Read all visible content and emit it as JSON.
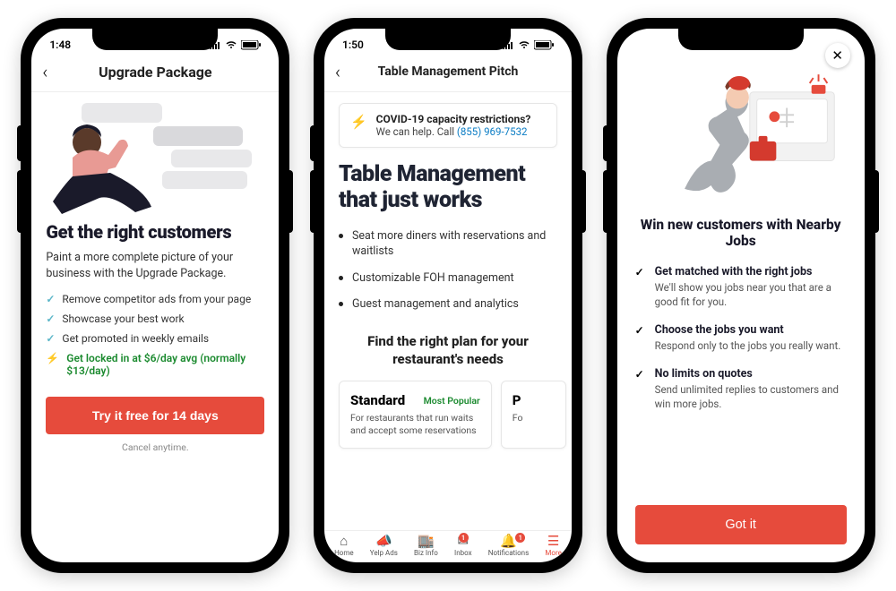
{
  "screen1": {
    "time": "1:48",
    "title": "Upgrade Package",
    "headline": "Get the right customers",
    "sub": "Paint a more complete picture of your business with the Upgrade Package.",
    "features": [
      "Remove competitor ads from your page",
      "Showcase your best work",
      "Get promoted in weekly emails"
    ],
    "promo": "Get locked in at $6/day avg (normally $13/day)",
    "cta": "Try it free for 14 days",
    "cancel": "Cancel anytime."
  },
  "screen2": {
    "time": "1:50",
    "title": "Table Management Pitch",
    "covid_title": "COVID-19 capacity restrictions?",
    "covid_sub_pre": "We can help. Call ",
    "covid_phone": "(855) 969-7532",
    "headline": "Table Management that just works",
    "bullets": [
      "Seat more diners with reservations and waitlists",
      "Customizable FOH management",
      "Guest management and analytics"
    ],
    "plan_heading": "Find the right plan for your restaurant's needs",
    "plan1_name": "Standard",
    "plan1_tag": "Most Popular",
    "plan1_desc": "For restaurants that run waits and accept some reservations",
    "plan2_name": "P",
    "plan2_desc": "Fo",
    "tabs": [
      {
        "label": "Home",
        "icon": "home-icon",
        "badge": null
      },
      {
        "label": "Yelp Ads",
        "icon": "megaphone-icon",
        "badge": null
      },
      {
        "label": "Biz Info",
        "icon": "storefront-icon",
        "badge": null
      },
      {
        "label": "Inbox",
        "icon": "envelope-icon",
        "badge": "1"
      },
      {
        "label": "Notifications",
        "icon": "bell-icon",
        "badge": "1"
      },
      {
        "label": "More",
        "icon": "menu-icon",
        "badge": null
      }
    ]
  },
  "screen3": {
    "headline": "Win new customers with Nearby Jobs",
    "items": [
      {
        "t": "Get matched with the right jobs",
        "d": "We'll show you jobs near you that are a good fit for you."
      },
      {
        "t": "Choose the jobs you want",
        "d": "Respond only to the jobs you really want."
      },
      {
        "t": "No limits on quotes",
        "d": "Send unlimited replies to customers and win more jobs."
      }
    ],
    "cta": "Got it"
  }
}
